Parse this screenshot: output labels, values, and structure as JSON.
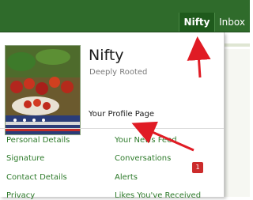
{
  "nav": {
    "tabs": [
      "Nifty",
      "Inbox"
    ]
  },
  "profile": {
    "name": "Nifty",
    "subtitle": "Deeply Rooted",
    "profile_link": "Your Profile Page"
  },
  "menu": {
    "left": [
      "Personal Details",
      "Signature",
      "Contact Details",
      "Privacy"
    ],
    "right": [
      "Your News Feed",
      "Conversations",
      "Alerts",
      "Likes You've Received"
    ]
  },
  "alerts_badge": "1",
  "colors": {
    "nav": "#2f6b2b",
    "link": "#2d7a2a",
    "annotation_arrow": "#e01b24",
    "badge": "#cc2b2b"
  }
}
